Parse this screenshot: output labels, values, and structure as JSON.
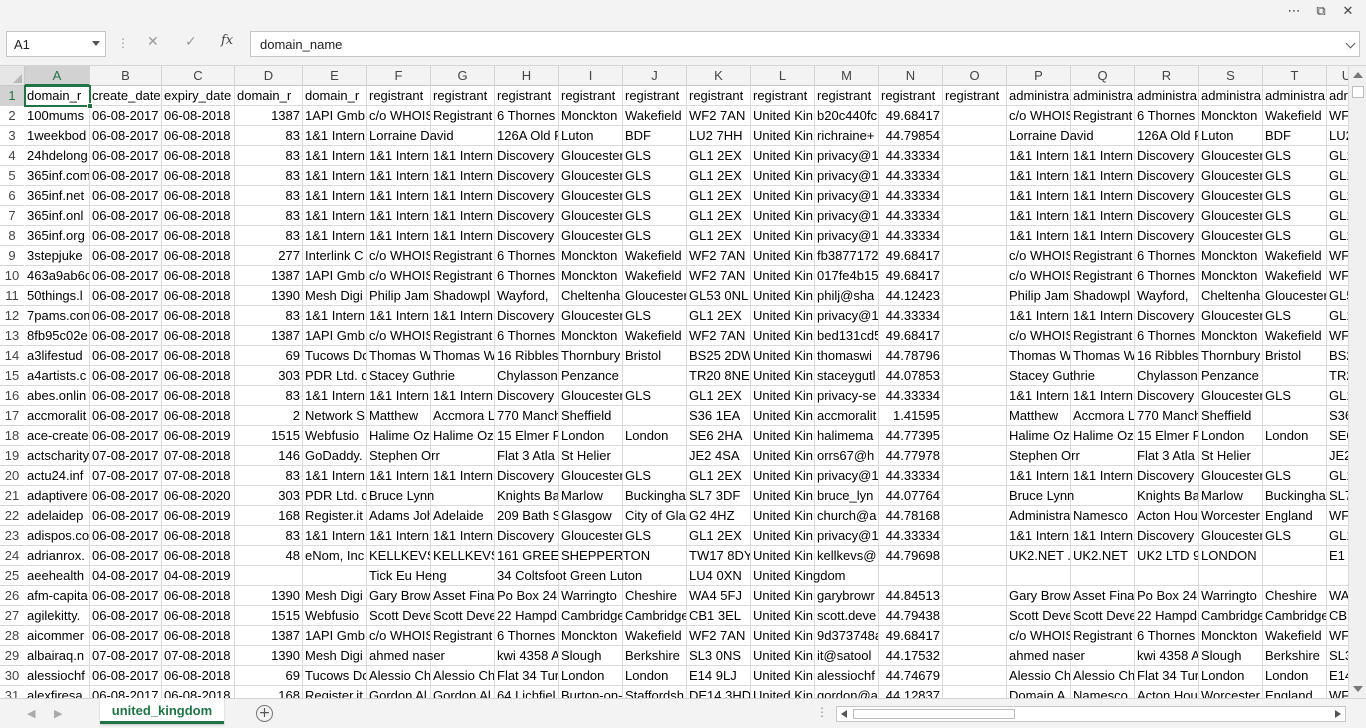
{
  "window": {
    "more_glyph": "⋯",
    "restore_glyph": "⧉",
    "close_glyph": "✕"
  },
  "formula_bar": {
    "name_box": "A1",
    "cancel_glyph": "✕",
    "enter_glyph": "✓",
    "fx_label": "fx",
    "dots_glyph": "⋮",
    "formula": "domain_name"
  },
  "grid": {
    "columns": [
      "A",
      "B",
      "C",
      "D",
      "E",
      "F",
      "G",
      "H",
      "I",
      "J",
      "K",
      "L",
      "M",
      "N",
      "O",
      "P",
      "Q",
      "R",
      "S",
      "T",
      "U"
    ],
    "selected_column": "A",
    "selected_row": 1,
    "rows": [
      [
        "domain_r",
        "create_date",
        "expiry_date",
        "domain_r",
        "domain_r",
        "registrant",
        "registrant",
        "registrant",
        "registrant",
        "registrant",
        "registrant",
        "registrant",
        "registrant",
        "registrant",
        "registrant",
        "administra",
        "administra",
        "administra",
        "administra",
        "administra",
        "adr"
      ],
      [
        "100mums",
        "06-08-2017",
        "06-08-2018",
        "1387",
        "1API Gmb",
        "c/o WHOIS",
        "Registrant",
        "6 Thornes",
        "Monckton",
        "Wakefield",
        "WF2 7AN",
        "United Kin",
        "b20c440fc",
        "49.68417",
        "",
        "c/o WHOIS",
        "Registrant",
        "6 Thornes",
        "Monckton",
        "Wakefield",
        "WF"
      ],
      [
        "1weekbod",
        "06-08-2017",
        "06-08-2018",
        "83",
        "1&1 Intern",
        "Lorraine David",
        "",
        "126A Old F",
        "Luton",
        "BDF",
        "LU2 7HH",
        "United Kin",
        "richraine+",
        "44.79854",
        "",
        "Lorraine David",
        "",
        "126A Old F",
        "Luton",
        "BDF",
        "LU2"
      ],
      [
        "24hdelong",
        "06-08-2017",
        "06-08-2018",
        "83",
        "1&1 Intern",
        "1&1 Intern",
        "1&1 Intern",
        "Discovery",
        "Gloucester",
        "GLS",
        "GL1 2EX",
        "United Kin",
        "privacy@1",
        "44.33334",
        "",
        "1&1 Intern",
        "1&1 Intern",
        "Discovery",
        "Gloucester",
        "GLS",
        "GL1"
      ],
      [
        "365inf.com",
        "06-08-2017",
        "06-08-2018",
        "83",
        "1&1 Intern",
        "1&1 Intern",
        "1&1 Intern",
        "Discovery",
        "Gloucester",
        "GLS",
        "GL1 2EX",
        "United Kin",
        "privacy@1",
        "44.33334",
        "",
        "1&1 Intern",
        "1&1 Intern",
        "Discovery",
        "Gloucester",
        "GLS",
        "GL1"
      ],
      [
        "365inf.net",
        "06-08-2017",
        "06-08-2018",
        "83",
        "1&1 Intern",
        "1&1 Intern",
        "1&1 Intern",
        "Discovery",
        "Gloucester",
        "GLS",
        "GL1 2EX",
        "United Kin",
        "privacy@1",
        "44.33334",
        "",
        "1&1 Intern",
        "1&1 Intern",
        "Discovery",
        "Gloucester",
        "GLS",
        "GL1"
      ],
      [
        "365inf.onl",
        "06-08-2017",
        "06-08-2018",
        "83",
        "1&1 Intern",
        "1&1 Intern",
        "1&1 Intern",
        "Discovery",
        "Gloucester",
        "GLS",
        "GL1 2EX",
        "United Kin",
        "privacy@1",
        "44.33334",
        "",
        "1&1 Intern",
        "1&1 Intern",
        "Discovery",
        "Gloucester",
        "GLS",
        "GL1"
      ],
      [
        "365inf.org",
        "06-08-2017",
        "06-08-2018",
        "83",
        "1&1 Intern",
        "1&1 Intern",
        "1&1 Intern",
        "Discovery",
        "Gloucester",
        "GLS",
        "GL1 2EX",
        "United Kin",
        "privacy@1",
        "44.33334",
        "",
        "1&1 Intern",
        "1&1 Intern",
        "Discovery",
        "Gloucester",
        "GLS",
        "GL1"
      ],
      [
        "3stepjuke",
        "06-08-2017",
        "06-08-2018",
        "277",
        "Interlink C",
        "c/o WHOIS",
        "Registrant",
        "6 Thornes",
        "Monckton",
        "Wakefield",
        "WF2 7AN",
        "United Kin",
        "fb3877172",
        "49.68417",
        "",
        "c/o WHOIS",
        "Registrant",
        "6 Thornes",
        "Monckton",
        "Wakefield",
        "WF"
      ],
      [
        "463a9ab6c",
        "06-08-2017",
        "06-08-2018",
        "1387",
        "1API Gmb",
        "c/o WHOIS",
        "Registrant",
        "6 Thornes",
        "Monckton",
        "Wakefield",
        "WF2 7AN",
        "United Kin",
        "017fe4b15",
        "49.68417",
        "",
        "c/o WHOIS",
        "Registrant",
        "6 Thornes",
        "Monckton",
        "Wakefield",
        "WF"
      ],
      [
        "50things.l",
        "06-08-2017",
        "06-08-2018",
        "1390",
        "Mesh Digi",
        "Philip Jam",
        "Shadowpl",
        "Wayford, ",
        "Cheltenha",
        "Gloucester",
        "GL53 0NL",
        "United Kin",
        "philj@sha",
        "44.12423",
        "",
        "Philip Jam",
        "Shadowpl",
        "Wayford, ",
        "Cheltenha",
        "Gloucester",
        "GL5"
      ],
      [
        "7pams.com",
        "06-08-2017",
        "06-08-2018",
        "83",
        "1&1 Intern",
        "1&1 Intern",
        "1&1 Intern",
        "Discovery",
        "Gloucester",
        "GLS",
        "GL1 2EX",
        "United Kin",
        "privacy@1",
        "44.33334",
        "",
        "1&1 Intern",
        "1&1 Intern",
        "Discovery",
        "Gloucester",
        "GLS",
        "GL1"
      ],
      [
        "8fb95c02e",
        "06-08-2017",
        "06-08-2018",
        "1387",
        "1API Gmb",
        "c/o WHOIS",
        "Registrant",
        "6 Thornes",
        "Monckton",
        "Wakefield",
        "WF2 7AN",
        "United Kin",
        "bed131cd5",
        "49.68417",
        "",
        "c/o WHOIS",
        "Registrant",
        "6 Thornes",
        "Monckton",
        "Wakefield",
        "WF"
      ],
      [
        "a3lifestud",
        "06-08-2017",
        "06-08-2018",
        "69",
        "Tucows Do",
        "Thomas W",
        "Thomas W",
        "16 Ribbles",
        "Thornbury",
        "Bristol",
        "BS25 2DW",
        "United Kin",
        "thomaswi",
        "44.78796",
        "",
        "Thomas W",
        "Thomas W",
        "16 Ribbles",
        "Thornbury",
        "Bristol",
        "BS2"
      ],
      [
        "a4artists.c",
        "06-08-2017",
        "06-08-2018",
        "303",
        "PDR Ltd. d",
        "Stacey Guthrie",
        "",
        "Chylasson",
        "Penzance",
        "",
        "TR20 8NE",
        "United Kin",
        "staceygutl",
        "44.07853",
        "",
        "Stacey Guthrie",
        "",
        "Chylasson",
        "Penzance",
        "",
        "TR2"
      ],
      [
        "abes.onlin",
        "06-08-2017",
        "06-08-2018",
        "83",
        "1&1 Intern",
        "1&1 Intern",
        "1&1 Intern",
        "Discovery",
        "Gloucester",
        "GLS",
        "GL1 2EX",
        "United Kin",
        "privacy-se",
        "44.33334",
        "",
        "1&1 Intern",
        "1&1 Intern",
        "Discovery",
        "Gloucester",
        "GLS",
        "GL1"
      ],
      [
        "accmoralit",
        "06-08-2017",
        "06-08-2018",
        "2",
        "Network S",
        "Matthew",
        "Accmora L",
        "770 Manch",
        "Sheffield",
        "",
        "S36 1EA",
        "United Kin",
        "accmoralit",
        "1.41595",
        "",
        "Matthew",
        "Accmora L",
        "770 Manch",
        "Sheffield",
        "",
        "S36"
      ],
      [
        "ace-create",
        "06-08-2017",
        "06-08-2019",
        "1515",
        "Webfusio",
        "Halime Oz",
        "Halime Oz",
        "15 Elmer F",
        "London",
        "London",
        "SE6 2HA",
        "United Kin",
        "halimema",
        "44.77395",
        "",
        "Halime Oz",
        "Halime Oz",
        "15 Elmer F",
        "London",
        "London",
        "SE6"
      ],
      [
        "actscharity",
        "07-08-2017",
        "07-08-2018",
        "146",
        "GoDaddy.",
        "Stephen Orr",
        "",
        "Flat 3 Atla",
        "St Helier",
        "",
        "JE2 4SA",
        "United Kin",
        "orrs67@h",
        "44.77978",
        "",
        "Stephen Orr",
        "",
        "Flat 3 Atla",
        "St Helier",
        "",
        "JE2"
      ],
      [
        "actu24.inf",
        "07-08-2017",
        "07-08-2018",
        "83",
        "1&1 Intern",
        "1&1 Intern",
        "1&1 Intern",
        "Discovery",
        "Gloucester",
        "GLS",
        "GL1 2EX",
        "United Kin",
        "privacy@1",
        "44.33334",
        "",
        "1&1 Intern",
        "1&1 Intern",
        "Discovery",
        "Gloucester",
        "GLS",
        "GL1"
      ],
      [
        "adaptivere",
        "06-08-2017",
        "06-08-2020",
        "303",
        "PDR Ltd. d",
        "Bruce Lynn",
        "",
        "Knights Ba",
        "Marlow",
        "Buckingha",
        "SL7 3DF",
        "United Kin",
        "bruce_lyn",
        "44.07764",
        "",
        "Bruce Lynn",
        "",
        "Knights Ba",
        "Marlow",
        "Buckingha",
        "SL7"
      ],
      [
        "adelaidep",
        "06-08-2017",
        "06-08-2019",
        "168",
        "Register.it",
        "Adams Joh",
        "Adelaide",
        "209 Bath S",
        "Glasgow",
        "City of Gla",
        "G2 4HZ",
        "United Kin",
        "church@a",
        "44.78168",
        "",
        "Administra",
        "Namesco",
        "Acton Hou",
        "Worcester",
        "England",
        "WF"
      ],
      [
        "adispos.co",
        "06-08-2017",
        "06-08-2018",
        "83",
        "1&1 Intern",
        "1&1 Intern",
        "1&1 Intern",
        "Discovery",
        "Gloucester",
        "GLS",
        "GL1 2EX",
        "United Kin",
        "privacy@1",
        "44.33334",
        "",
        "1&1 Intern",
        "1&1 Intern",
        "Discovery",
        "Gloucester",
        "GLS",
        "GL1"
      ],
      [
        "adrianrox.",
        "06-08-2017",
        "06-08-2018",
        "48",
        "eNom, Inc",
        "KELLKEVS",
        "KELLKEVS",
        "161 GREEN",
        "SHEPPERTON",
        "",
        "TW17 8DY",
        "United Kin",
        "kellkevs@",
        "44.79698",
        "",
        "UK2.NET ..",
        "UK2.NET",
        "UK2 LTD 9",
        "LONDON",
        "",
        "E1"
      ],
      [
        "aeehealth",
        "04-08-2017",
        "04-08-2019",
        "",
        "",
        "Tick Eu Heng",
        "",
        "34 Coltsfoot Green Luton",
        "",
        "",
        "LU4 0XN",
        "United Kingdom",
        "",
        "",
        "",
        "",
        "",
        "",
        "",
        "",
        ""
      ],
      [
        "afm-capita",
        "06-08-2017",
        "06-08-2018",
        "1390",
        "Mesh Digi",
        "Gary Brow",
        "Asset Fina",
        "Po Box 24",
        "Warringto",
        "Cheshire",
        "WA4 5FJ",
        "United Kin",
        "garybrowr",
        "44.84513",
        "",
        "Gary Brow",
        "Asset Fina",
        "Po Box 24",
        "Warringto",
        "Cheshire",
        "WA"
      ],
      [
        "agilekitty.",
        "06-08-2017",
        "06-08-2018",
        "1515",
        "Webfusio",
        "Scott Deve",
        "Scott Deve",
        "22 Hampd",
        "Cambridge",
        "Cambridge",
        "CB1 3EL",
        "United Kin",
        "scott.deve",
        "44.79438",
        "",
        "Scott Deve",
        "Scott Deve",
        "22 Hampd",
        "Cambridge",
        "Cambridge",
        "CB1"
      ],
      [
        "aicommer",
        "06-08-2017",
        "06-08-2018",
        "1387",
        "1API Gmb",
        "c/o WHOIS",
        "Registrant",
        "6 Thornes",
        "Monckton",
        "Wakefield",
        "WF2 7AN",
        "United Kin",
        "9d373748a",
        "49.68417",
        "",
        "c/o WHOIS",
        "Registrant",
        "6 Thornes",
        "Monckton",
        "Wakefield",
        "WF"
      ],
      [
        "albairaq.n",
        "07-08-2017",
        "07-08-2018",
        "1390",
        "Mesh Digi",
        "ahmed naser",
        "",
        "kwi 4358 A",
        "Slough",
        "Berkshire",
        "SL3 0NS",
        "United Kin",
        "it@satool",
        "44.17532",
        "",
        "ahmed naser",
        "",
        "kwi 4358 A",
        "Slough",
        "Berkshire",
        "SL3"
      ],
      [
        "alessiochf",
        "06-08-2017",
        "06-08-2018",
        "69",
        "Tucows Do",
        "Alessio Ch",
        "Alessio Ch",
        "Flat 34 Tur",
        "London",
        "London",
        "E14 9LJ",
        "United Kin",
        "alessiochf",
        "44.74679",
        "",
        "Alessio Ch",
        "Alessio Ch",
        "Flat 34 Tur",
        "London",
        "London",
        "E14"
      ],
      [
        "alexfiresa",
        "06-08-2017",
        "06-08-2018",
        "168",
        "Register.it",
        "Gordon Al",
        "Gordon Al",
        "64 Lichfiel",
        "Burton-on-",
        "Staffordsh",
        "DE14 3HD",
        "United Kin",
        "gordon@a",
        "44.12837",
        "",
        "Domain A",
        "Namesco",
        "Acton Hou",
        "Worcester",
        "England",
        "WF"
      ]
    ]
  },
  "sheet_tabs": {
    "active": "united_kingdom",
    "add_glyph": "+",
    "prev_glyph": "◀",
    "next_glyph": "▶",
    "dots_glyph": "⋮"
  },
  "accent_color": "#217346"
}
